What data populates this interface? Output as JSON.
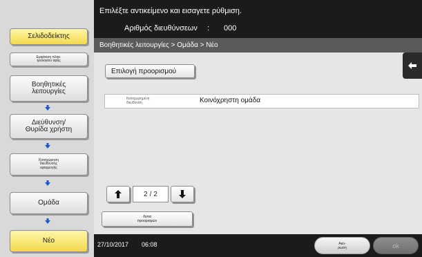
{
  "header": {
    "message": "Επιλέξτε αντικείμενο και εισαγετε ρύθμιση.",
    "address_number_label": "Αριθμός διευθύνσεων",
    "address_number_sep": ":",
    "address_number_value": "000"
  },
  "sidebar": {
    "bookmark_label": "Σελιδοδείκτης",
    "quick_label": "Εμφάνιση πληκ-\nτρολογίου αφής",
    "items": [
      {
        "label": "Βοηθητικές\nλειτουργίες"
      },
      {
        "label": "Διεύθυνση/\nΘυρίδα χρήστη"
      },
      {
        "label": "Καταχώρηση\nδιεύθυνσης\nεφαρμογής"
      },
      {
        "label": "Ομάδα"
      },
      {
        "label": "Νέο"
      }
    ]
  },
  "main": {
    "breadcrumb": "Βοηθητικές λειτουργίες > Ομάδα > Νέο",
    "select_destination_label": "Επιλογή προορισμού",
    "field": {
      "label": "Καταχωρημένη\nδιεύθυνση",
      "value": "Κοινόχρηστη ομάδα"
    },
    "pager": {
      "current": "2",
      "sep": "/",
      "total": "2"
    },
    "list_button_label": "Λίστα\nπροορισμών"
  },
  "footer": {
    "date": "27/10/2017",
    "time": "06:08",
    "cancel_label": "Ακύ-\nρωση",
    "ok_label": "ok"
  }
}
